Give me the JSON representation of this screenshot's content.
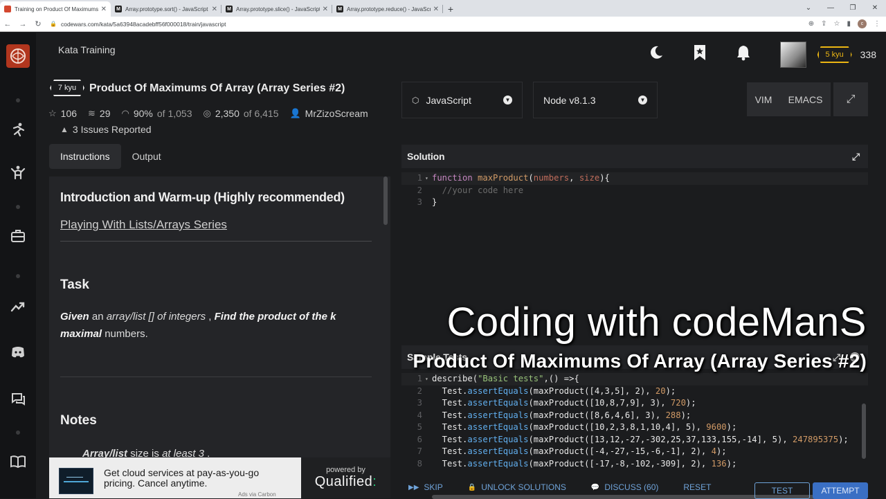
{
  "browser": {
    "tabs": [
      {
        "title": "Training on Product Of Maximums",
        "favicon": "codewars-icon",
        "active": true
      },
      {
        "title": "Array.prototype.sort() - JavaScript",
        "favicon": "mdn-icon",
        "active": false
      },
      {
        "title": "Array.prototype.slice() - JavaScript",
        "favicon": "mdn-icon",
        "active": false
      },
      {
        "title": "Array.prototype.reduce() - JavaScript",
        "favicon": "mdn-icon",
        "active": false
      }
    ],
    "url": "codewars.com/kata/5a63948acadebff56f000018/train/javascript",
    "profile_initial": "c"
  },
  "header": {
    "page_label": "Kata Training",
    "rank": "5 kyu",
    "honor": "338"
  },
  "kata": {
    "kyu": "7 kyu",
    "title": "Product Of Maximums Of Array (Array Series #2)",
    "stars": "106",
    "collections": "29",
    "satisfaction": "90%",
    "satisfaction_of": "of 1,053",
    "completed": "2,350",
    "completed_of": "of 6,415",
    "author": "MrZizoScream",
    "issues": "3 Issues Reported"
  },
  "left_tabs": [
    "Instructions",
    "Output"
  ],
  "instructions": {
    "intro_heading": "Introduction and Warm-up (Highly recommended)",
    "series_link": "Playing With Lists/Arrays Series",
    "task_heading": "Task",
    "task_given": "Given",
    "task_an": " an ",
    "task_array": "array/list [] of integers",
    "task_comma": " , ",
    "task_find": "Find the product of the k maximal",
    "task_numbers": " numbers.",
    "notes_heading": "Notes",
    "note1_bold": "Array/list",
    "note1_mid": " size is ",
    "note1_it": "at least 3",
    "note1_end": " ."
  },
  "ad": {
    "text": "Get cloud services at pay-as-you-go pricing. Cancel anytime.",
    "via": "Ads via Carbon",
    "powered": "powered by",
    "brand": "Qualified",
    "brand_mark": ":"
  },
  "toolbar": {
    "language": "JavaScript",
    "runtime": "Node v8.1.3",
    "vim": "VIM",
    "emacs": "EMACS"
  },
  "solution": {
    "title": "Solution",
    "lines": [
      {
        "n": "1",
        "kw": "function ",
        "name": "maxProduct",
        "open": "(",
        "p1": "numbers",
        "sep": ", ",
        "p2": "size",
        "close": "){"
      },
      {
        "n": "2",
        "comment": "  //your code here"
      },
      {
        "n": "3",
        "plain": "}"
      }
    ]
  },
  "sample_tests": {
    "title": "Sample Tests",
    "line1": {
      "n": "1",
      "a": "describe(",
      "s": "\"Basic tests\"",
      "b": ",() =>{"
    },
    "lines": [
      {
        "n": "2",
        "args": "[4,3,5], 2",
        "expect": "20"
      },
      {
        "n": "3",
        "args": "[10,8,7,9], 3",
        "expect": "720"
      },
      {
        "n": "4",
        "args": "[8,6,4,6], 3",
        "expect": "288"
      },
      {
        "n": "5",
        "args": "[10,2,3,8,1,10,4], 5",
        "expect": "9600"
      },
      {
        "n": "6",
        "args": "[13,12,-27,-302,25,37,133,155,-14], 5",
        "expect": "247895375"
      },
      {
        "n": "7",
        "args": "[-4,-27,-15,-6,-1], 2",
        "expect": "4"
      },
      {
        "n": "8",
        "args": "[-17,-8,-102,-309], 2",
        "expect": "136"
      }
    ]
  },
  "actions": {
    "skip": "SKIP",
    "unlock": "UNLOCK SOLUTIONS",
    "discuss": "DISCUSS (60)",
    "reset": "RESET",
    "test": "TEST",
    "attempt": "ATTEMPT"
  },
  "overlay": {
    "channel": "Coding with codeManS",
    "subtitle": "Product Of Maximums Of Array (Array Series #2)"
  }
}
